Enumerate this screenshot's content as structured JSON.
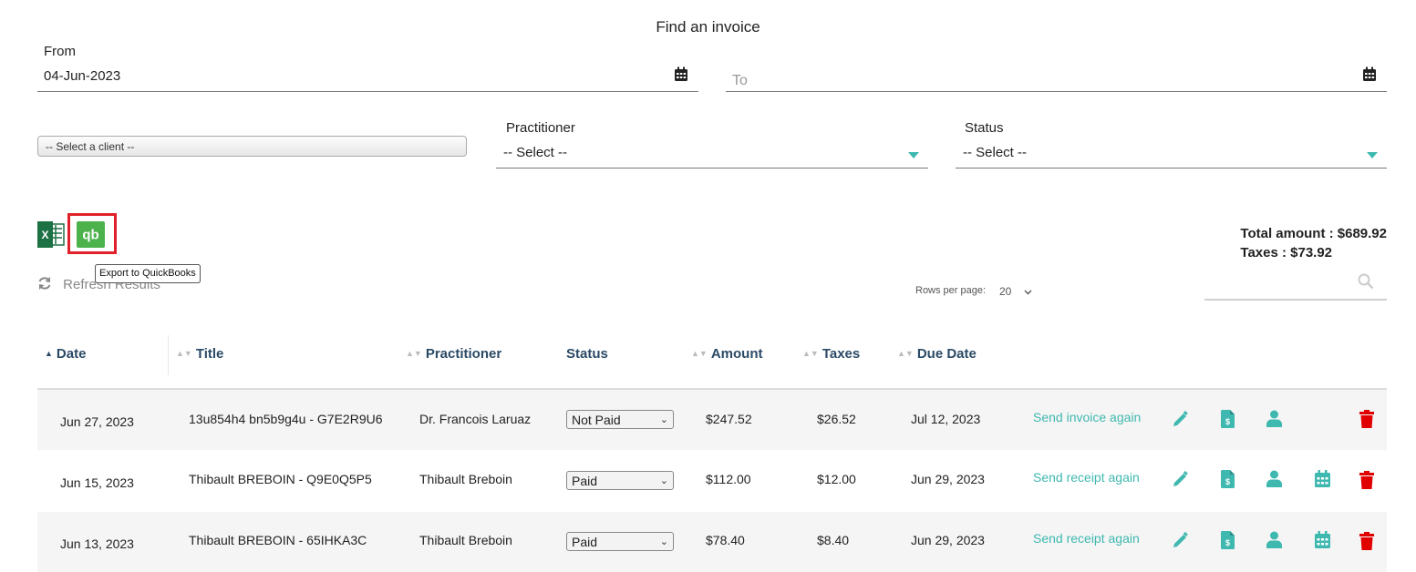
{
  "page": {
    "title": "Find an invoice"
  },
  "filters": {
    "from_label": "From",
    "from_value": "04-Jun-2023",
    "to_placeholder": "To",
    "client_placeholder": "-- Select a client --",
    "practitioner_label": "Practitioner",
    "practitioner_value": "-- Select --",
    "status_label": "Status",
    "status_value": "-- Select --"
  },
  "toolbar": {
    "excel_letter": "X",
    "quickbooks_glyph": "qb",
    "tooltip": "Export to QuickBooks",
    "refresh_label": "Refresh Results"
  },
  "summary": {
    "total_amount": "Total amount : $689.92",
    "taxes": "Taxes : $73.92"
  },
  "pagination": {
    "rows_per_page_label": "Rows per page:",
    "rows_per_page_value": "20"
  },
  "table": {
    "columns": [
      "Date",
      "Title",
      "Practitioner",
      "Status",
      "Amount",
      "Taxes",
      "Due Date"
    ],
    "rows": [
      {
        "date": "Jun 27, 2023",
        "title": "13u854h4 bn5b9g4u - G7E2R9U6",
        "practitioner": "Dr. Francois Laruaz",
        "status": "Not Paid",
        "amount": "$247.52",
        "taxes": "$26.52",
        "due_date": "Jul 12, 2023",
        "action": "Send invoice again"
      },
      {
        "date": "Jun 15, 2023",
        "title": "Thibault BREBOIN - Q9E0Q5P5",
        "practitioner": "Thibault Breboin",
        "status": "Paid",
        "amount": "$112.00",
        "taxes": "$12.00",
        "due_date": "Jun 29, 2023",
        "action": "Send receipt again"
      },
      {
        "date": "Jun 13, 2023",
        "title": "Thibault BREBOIN - 65IHKA3C",
        "practitioner": "Thibault Breboin",
        "status": "Paid",
        "amount": "$78.40",
        "taxes": "$8.40",
        "due_date": "Jun 29, 2023",
        "action": "Send receipt again"
      }
    ]
  },
  "colors": {
    "accent": "#3fb8b0",
    "header_text": "#2b4a66",
    "delete": "#e00000",
    "quickbooks": "#4cb24c",
    "excel": "#1e7145",
    "highlight": "#e0202a"
  }
}
